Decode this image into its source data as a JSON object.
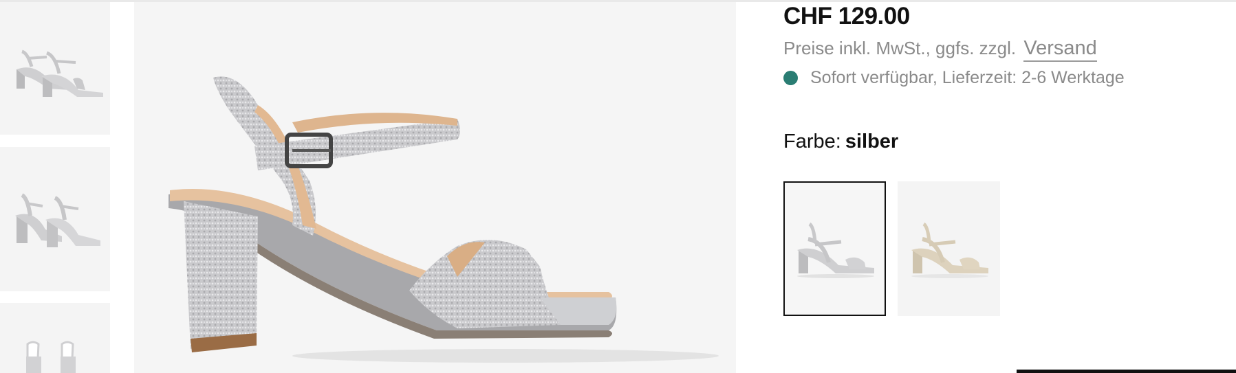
{
  "product": {
    "price": "CHF 129.00",
    "tax_note": "Preise inkl. MwSt., ggfs. zzgl.",
    "shipping_link": "Versand",
    "availability": "Sofort verfügbar, Lieferzeit: 2-6 Werktage",
    "availability_color": "#2a7d73",
    "color_label": "Farbe:",
    "color_value": "silber"
  },
  "gallery": {
    "thumbnails": [
      {
        "name": "silver-sandal-side"
      },
      {
        "name": "silver-sandal-pair-side"
      },
      {
        "name": "silver-sandal-front"
      }
    ]
  },
  "color_swatches": [
    {
      "name": "silber",
      "selected": true,
      "color": "#c4c4c6"
    },
    {
      "name": "beige",
      "selected": false,
      "color": "#d9cdb8"
    }
  ]
}
